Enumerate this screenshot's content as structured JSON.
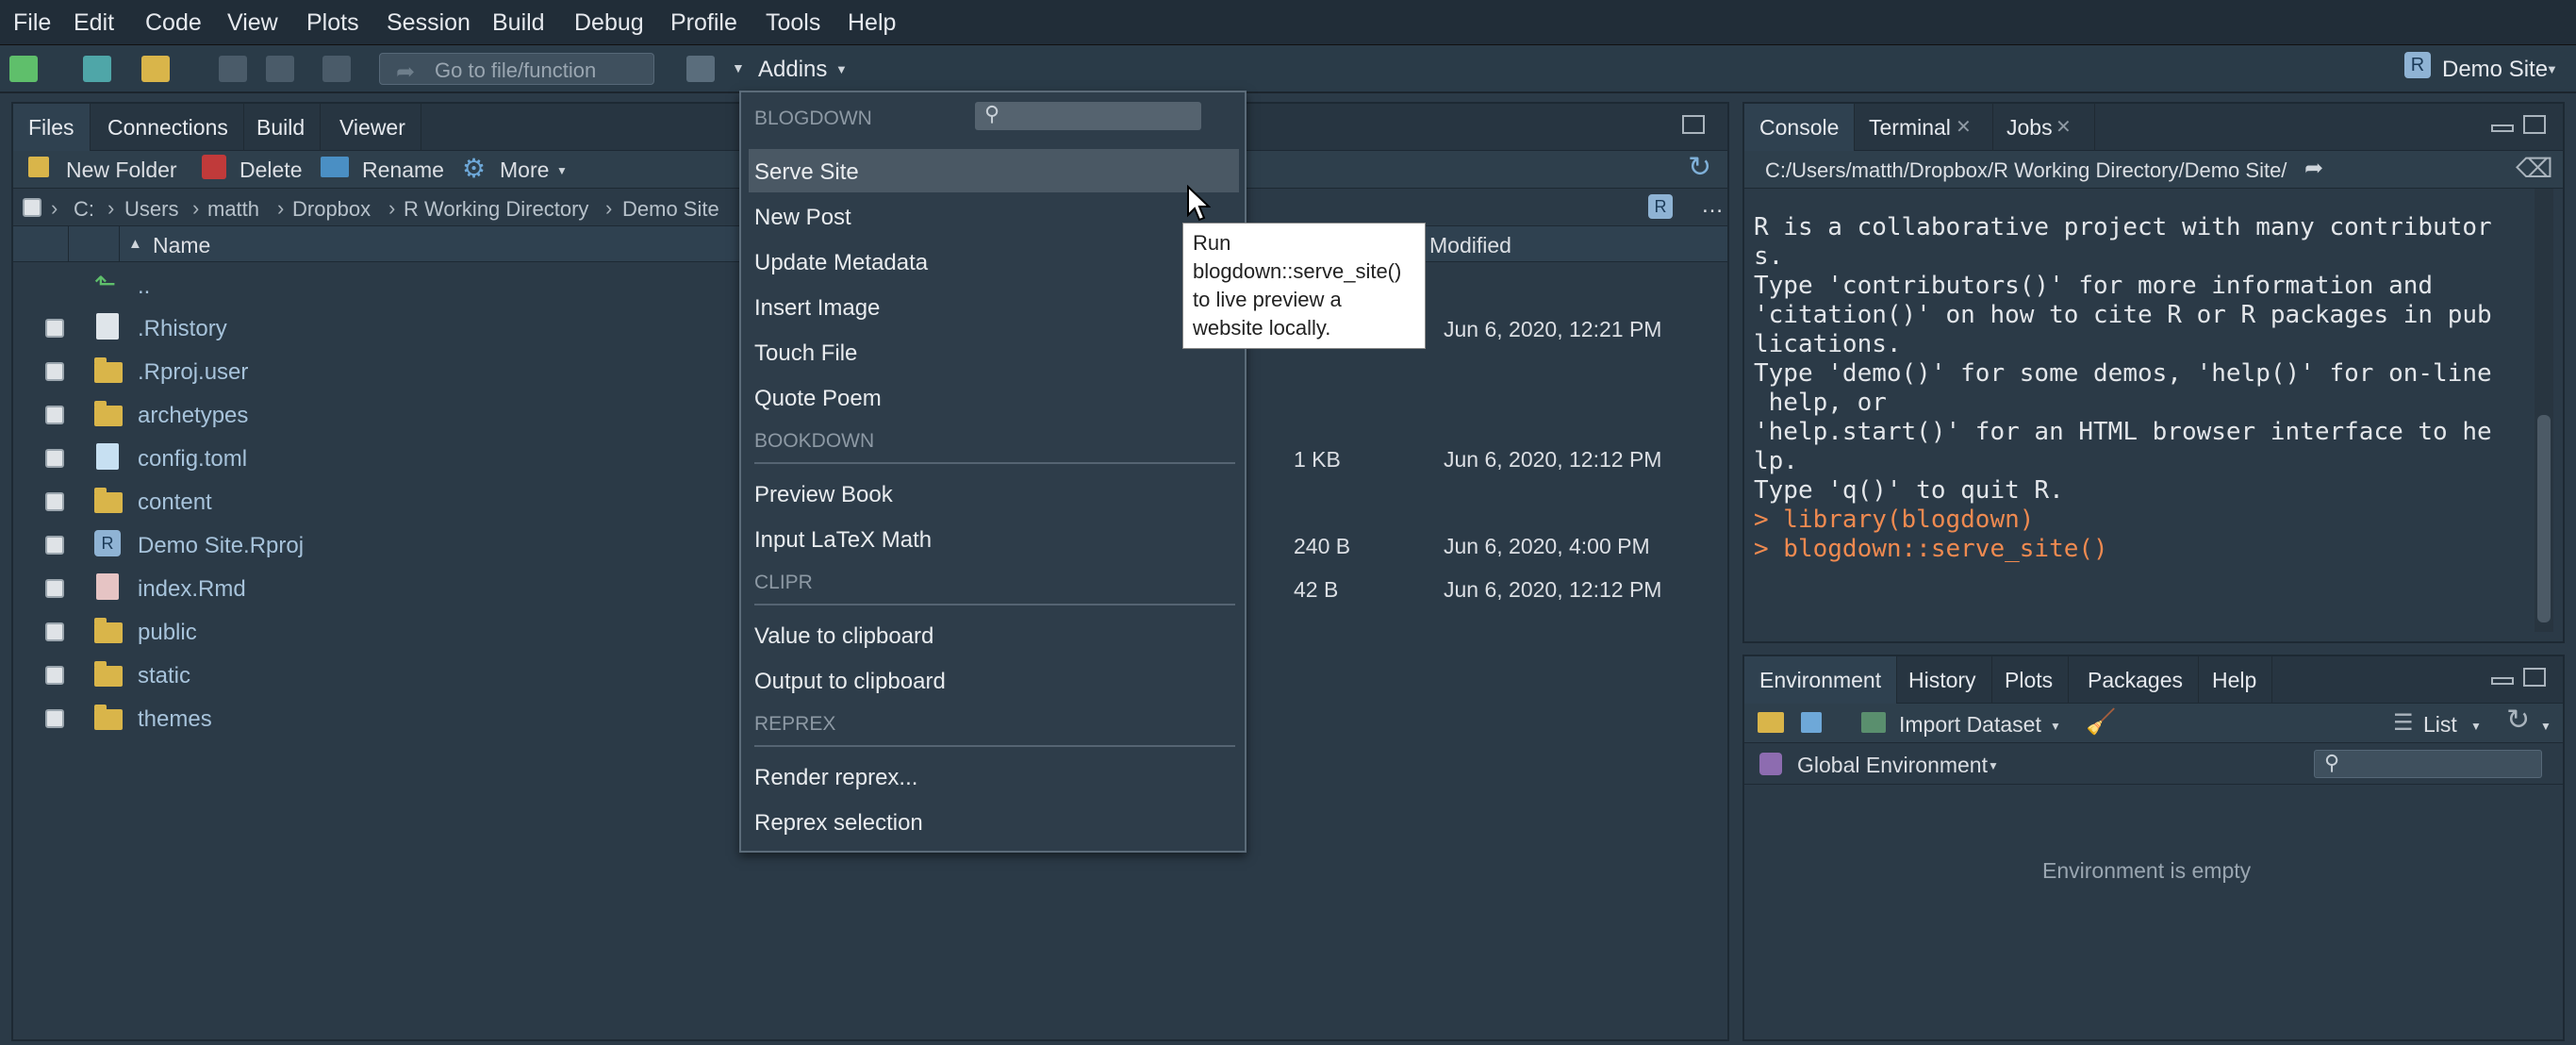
{
  "menu": [
    "File",
    "Edit",
    "Code",
    "View",
    "Plots",
    "Session",
    "Build",
    "Debug",
    "Profile",
    "Tools",
    "Help"
  ],
  "toolbar": {
    "goto_placeholder": "Go to file/function",
    "addins_label": "Addins",
    "project_label": "Demo Site"
  },
  "files_pane": {
    "tabs": [
      "Files",
      "Connections",
      "Build",
      "Viewer"
    ],
    "actions": {
      "new_folder": "New Folder",
      "delete": "Delete",
      "rename": "Rename",
      "more": "More"
    },
    "breadcrumb": [
      "C:",
      "Users",
      "matth",
      "Dropbox",
      "R Working Directory",
      "Demo Site"
    ],
    "columns": {
      "name": "Name",
      "modified": "Modified"
    },
    "up_label": "..",
    "files": [
      {
        "name": ".Rhistory",
        "size": "",
        "modified": "Jun 6, 2020, 12:21 PM"
      },
      {
        "name": ".Rproj.user",
        "size": "",
        "modified": ""
      },
      {
        "name": "archetypes",
        "size": "",
        "modified": ""
      },
      {
        "name": "config.toml",
        "size": "1 KB",
        "modified": "Jun 6, 2020, 12:12 PM"
      },
      {
        "name": "content",
        "size": "",
        "modified": ""
      },
      {
        "name": "Demo Site.Rproj",
        "size": "240 B",
        "modified": "Jun 6, 2020, 4:00 PM"
      },
      {
        "name": "index.Rmd",
        "size": "42 B",
        "modified": "Jun 6, 2020, 12:12 PM"
      },
      {
        "name": "public",
        "size": "",
        "modified": ""
      },
      {
        "name": "static",
        "size": "",
        "modified": ""
      },
      {
        "name": "themes",
        "size": "",
        "modified": ""
      }
    ]
  },
  "addins_menu": {
    "sections": [
      {
        "header": "BLOGDOWN",
        "items": [
          "Serve Site",
          "New Post",
          "Update Metadata",
          "Insert Image",
          "Touch File",
          "Quote Poem"
        ]
      },
      {
        "header": "BOOKDOWN",
        "items": [
          "Preview Book",
          "Input LaTeX Math"
        ]
      },
      {
        "header": "CLIPR",
        "items": [
          "Value to clipboard",
          "Output to clipboard"
        ]
      },
      {
        "header": "REPREX",
        "items": [
          "Render reprex...",
          "Reprex selection"
        ]
      }
    ],
    "tooltip": [
      "Run",
      "blogdown::serve_site()",
      "to live preview a",
      "website locally."
    ]
  },
  "console_pane": {
    "tabs": [
      "Console",
      "Terminal",
      "Jobs"
    ],
    "path": "C:/Users/matth/Dropbox/R Working Directory/Demo Site/",
    "lines": [
      "R is a collaborative project with many contributor",
      "s.",
      "Type 'contributors()' for more information and",
      "'citation()' on how to cite R or R packages in pub",
      "lications.",
      "",
      "Type 'demo()' for some demos, 'help()' for on-line",
      " help, or",
      "'help.start()' for an HTML browser interface to he",
      "lp.",
      "Type 'q()' to quit R.",
      ""
    ],
    "commands": [
      "> library(blogdown)",
      "> blogdown::serve_site()"
    ]
  },
  "env_pane": {
    "tabs": [
      "Environment",
      "History",
      "Plots",
      "Packages",
      "Help"
    ],
    "import_label": "Import Dataset",
    "view_label": "List",
    "scope_label": "Global Environment",
    "empty_label": "Environment is empty"
  },
  "colors": {
    "background": "#2b3a47",
    "accent_folder": "#d9b54a",
    "prompt": "#f08a50",
    "link": "#a7c3db"
  }
}
